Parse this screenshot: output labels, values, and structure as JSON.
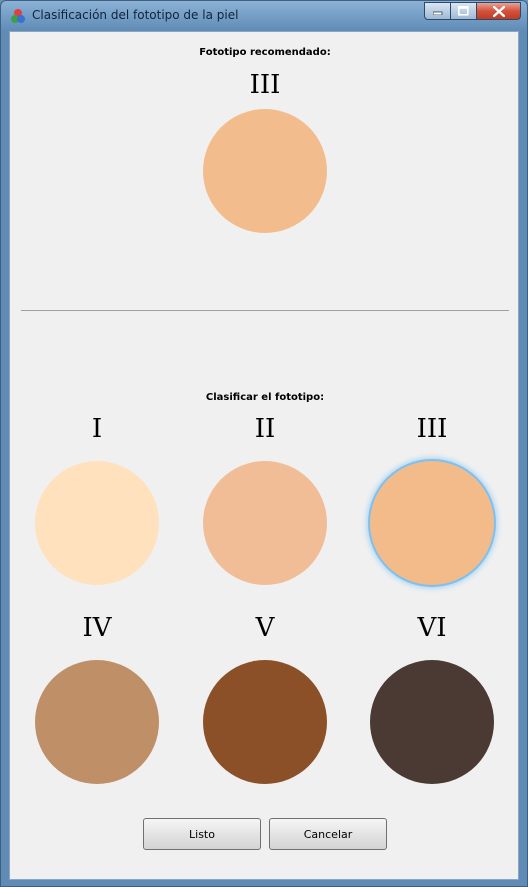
{
  "window": {
    "title": "Clasificación del fototipo de la piel",
    "controls": {
      "minimize_icon": "minimize-icon",
      "maximize_icon": "maximize-icon",
      "close_icon": "close-icon"
    }
  },
  "recommended": {
    "heading": "Fototipo recomendado:",
    "numeral": "III",
    "color": "#F3BC8C"
  },
  "classify": {
    "heading": "Clasificar el fototipo:",
    "selected": "III",
    "phototypes": [
      {
        "numeral": "I",
        "color": "#FFE1BE"
      },
      {
        "numeral": "II",
        "color": "#F0BD96"
      },
      {
        "numeral": "III",
        "color": "#F3BB8A"
      },
      {
        "numeral": "IV",
        "color": "#BF8F68"
      },
      {
        "numeral": "V",
        "color": "#8B5027"
      },
      {
        "numeral": "VI",
        "color": "#4B3933"
      }
    ]
  },
  "buttons": {
    "ok_label": "Listo",
    "cancel_label": "Cancelar"
  }
}
